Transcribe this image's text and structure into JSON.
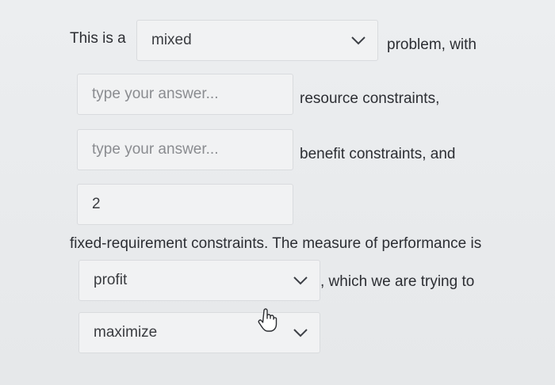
{
  "line1": {
    "prefix": "This is a",
    "problem_type_select": {
      "value": "mixed"
    },
    "suffix": "problem, with"
  },
  "answers": [
    {
      "placeholder": "type your answer...",
      "label": "resource constraints,"
    },
    {
      "placeholder": "type your answer...",
      "label": "benefit constraints, and"
    },
    {
      "value": "2"
    }
  ],
  "sentence2": "fixed-requirement constraints. The measure of performance is",
  "measure_select": {
    "value": "profit"
  },
  "after_measure": ", which we are trying to",
  "objective_select": {
    "value": "maximize"
  },
  "icons": {
    "dropdown": "chevron-down-icon",
    "cursor": "hand-pointer-icon"
  }
}
